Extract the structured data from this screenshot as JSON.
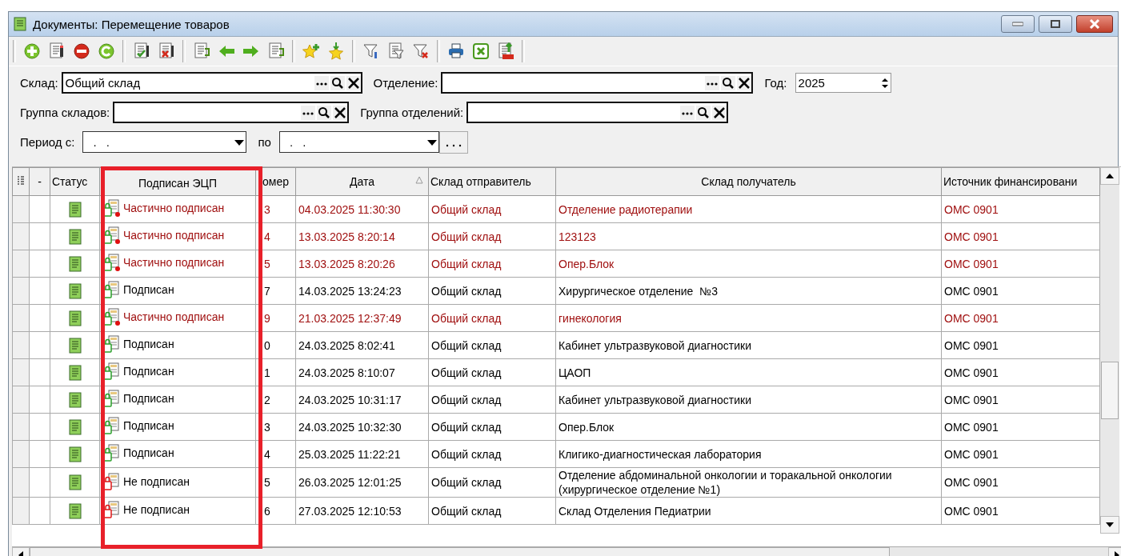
{
  "window": {
    "title": "Документы: Перемещение товаров"
  },
  "filter_rows": [
    [
      {
        "kind": "lookup",
        "label": "Склад:",
        "value": "Общий склад"
      },
      {
        "kind": "lookup",
        "label": "Отделение:"
      },
      {
        "kind": "spin",
        "label": "Год:",
        "value": "2025"
      }
    ],
    [
      {
        "kind": "lookup",
        "label": "Группа складов:"
      },
      {
        "kind": "lookup",
        "label": "Группа отделений:"
      }
    ],
    [
      {
        "kind": "date",
        "label": "Период с:",
        "value": ". ."
      },
      {
        "kind": "date_range",
        "label": "по",
        "value": ". ."
      }
    ]
  ],
  "table": {
    "columns": [
      {
        "label": "-"
      },
      {
        "label": "Статус"
      },
      {
        "label": "Подписан ЭЦП"
      },
      {
        "label": "омер"
      },
      {
        "label": "Дата",
        "sorted": true
      },
      {
        "label": "Склад отправитель"
      },
      {
        "label": "Склад получатель"
      },
      {
        "label": "Источник финансировани"
      }
    ],
    "rows": [
      {
        "flagged": true,
        "kind": "partial",
        "sign_text": "Частично подписан",
        "number": "3",
        "date": "04.03.2025 11:30:30",
        "sender": "Общий склад",
        "receiver": "Отделение радиотерапии",
        "source": "ОМС 0901"
      },
      {
        "flagged": true,
        "kind": "partial",
        "sign_text": "Частично подписан",
        "number": "4",
        "date": "13.03.2025 8:20:14",
        "sender": "Общий склад",
        "receiver": "123123",
        "source": "ОМС 0901"
      },
      {
        "flagged": true,
        "kind": "partial",
        "sign_text": "Частично подписан",
        "number": "5",
        "date": "13.03.2025 8:20:26",
        "sender": "Общий склад",
        "receiver": "Опер.Блок",
        "source": "ОМС 0901"
      },
      {
        "flagged": false,
        "kind": "signed",
        "sign_text": "Подписан",
        "number": "7",
        "date": "14.03.2025 13:24:23",
        "sender": "Общий склад",
        "receiver": "Хирургическое отделение  №3",
        "source": "ОМС 0901"
      },
      {
        "flagged": true,
        "kind": "partial",
        "sign_text": "Частично подписан",
        "number": "9",
        "date": "21.03.2025 12:37:49",
        "sender": "Общий склад",
        "receiver": "гинекология",
        "source": "ОМС 0901"
      },
      {
        "flagged": false,
        "kind": "signed",
        "sign_text": "Подписан",
        "number": "0",
        "date": "24.03.2025 8:02:41",
        "sender": "Общий склад",
        "receiver": "Кабинет ультразвуковой диагностики",
        "source": "ОМС 0901"
      },
      {
        "flagged": false,
        "kind": "signed",
        "sign_text": "Подписан",
        "number": "1",
        "date": "24.03.2025 8:10:07",
        "sender": "Общий склад",
        "receiver": "ЦАОП",
        "source": "ОМС 0901"
      },
      {
        "flagged": false,
        "kind": "signed",
        "sign_text": "Подписан",
        "number": "2",
        "date": "24.03.2025 10:31:17",
        "sender": "Общий склад",
        "receiver": "Кабинет ультразвуковой диагностики",
        "source": "ОМС 0901"
      },
      {
        "flagged": false,
        "kind": "signed",
        "sign_text": "Подписан",
        "number": "3",
        "date": "24.03.2025 10:32:30",
        "sender": "Общий склад",
        "receiver": "Опер.Блок",
        "source": "ОМС 0901"
      },
      {
        "flagged": false,
        "kind": "signed",
        "sign_text": "Подписан",
        "number": "4",
        "date": "25.03.2025 11:22:21",
        "sender": "Общий склад",
        "receiver": "Клигико-диагностическая лаборатория",
        "source": "ОМС 0901"
      },
      {
        "flagged": false,
        "kind": "unsigned",
        "sign_text": "Не подписан",
        "number": "5",
        "date": "26.03.2025 12:01:25",
        "sender": "Общий склад",
        "receiver": "Отделение абдоминальной онкологии и торакальной онкологии (хирургическое отделение №1)",
        "source": "ОМС 0901"
      },
      {
        "flagged": false,
        "kind": "unsigned",
        "sign_text": "Не подписан",
        "number": "6",
        "date": "27.03.2025 12:10:53",
        "sender": "Общий склад",
        "receiver": "Склад Отделения Педиатрии",
        "source": "ОМС 0901"
      }
    ]
  }
}
